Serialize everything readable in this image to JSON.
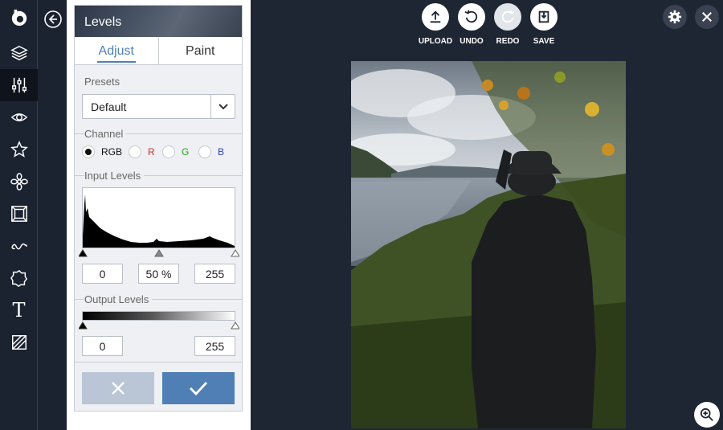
{
  "app": {
    "logo_letter": "b"
  },
  "rail": {
    "items": [
      {
        "icon": "layers-icon"
      },
      {
        "icon": "sliders-icon",
        "active": true
      },
      {
        "icon": "eye-icon"
      },
      {
        "icon": "star-icon"
      },
      {
        "icon": "flower-icon"
      },
      {
        "icon": "frame-icon"
      },
      {
        "icon": "texture-icon"
      },
      {
        "icon": "shape-icon"
      },
      {
        "icon": "text-icon",
        "glyph": "T"
      },
      {
        "icon": "overlay-icon"
      }
    ]
  },
  "panel": {
    "title": "Levels",
    "tabs": [
      {
        "label": "Adjust",
        "active": true
      },
      {
        "label": "Paint"
      }
    ],
    "presets": {
      "label": "Presets",
      "value": "Default"
    },
    "channel": {
      "label": "Channel",
      "options": [
        {
          "label": "RGB",
          "color": "#111111",
          "selected": true
        },
        {
          "label": "R",
          "color": "#d42a2a"
        },
        {
          "label": "G",
          "color": "#2a9a2a"
        },
        {
          "label": "B",
          "color": "#2a3fb0"
        }
      ]
    },
    "input_levels": {
      "label": "Input Levels",
      "black": "0",
      "mid": "50 %",
      "white": "255"
    },
    "output_levels": {
      "label": "Output Levels",
      "black": "0",
      "white": "255"
    }
  },
  "toolbar": {
    "upload": "UPLOAD",
    "undo": "UNDO",
    "redo": "REDO",
    "save": "SAVE"
  },
  "colors": {
    "accent": "#4f7fb5",
    "background": "#1f2633",
    "cancel": "#bac6d6"
  }
}
